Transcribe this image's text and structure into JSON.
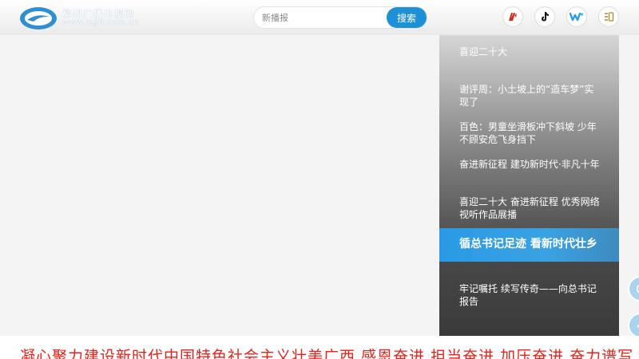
{
  "header": {
    "logo": {
      "name_cn": "柳州广播电视网",
      "url": "www.lzgd.com.cn"
    },
    "search": {
      "placeholder": "新播报",
      "button_label": "搜索"
    },
    "icons": [
      "weibo-app-icon",
      "douyin-icon",
      "wechat-icon",
      "menu-list-icon"
    ]
  },
  "playlist": {
    "items": [
      {
        "label": "喜迎二十大",
        "active": false
      },
      {
        "label": "谢评周：小土坡上的“造车梦”实现了",
        "active": false
      },
      {
        "label": "百色：男童坐滑板冲下斜坡  少年不顾安危飞身挡下",
        "active": false
      },
      {
        "label": "奋进新征程  建功新时代·非凡十年",
        "active": false
      },
      {
        "label": "喜迎二十大  奋进新征程  优秀网络视听作品展播",
        "active": false
      },
      {
        "label": "循总书记足迹  看新时代壮乡",
        "active": true
      },
      {
        "label": "牢记嘱托  续写传奇——向总书记报告",
        "active": false
      }
    ]
  },
  "ticker": {
    "text": "凝心聚力建设新时代中国特色社会主义壮美广西      感恩奋进  担当奋进  加压奋进  奋力谱写"
  },
  "colors": {
    "accent": "#1e90d6",
    "ticker_red": "#e8221a",
    "active_item": "#2a9ae6"
  }
}
